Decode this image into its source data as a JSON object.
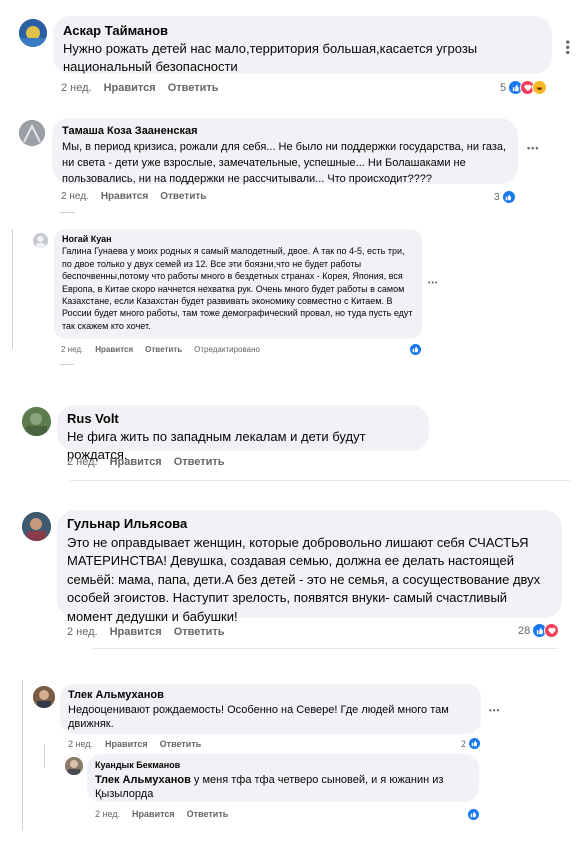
{
  "comments": [
    {
      "author": "Аскар Тайманов",
      "text": "Нужно рожать детей нас мало,территория большая,касается угрозы национальный безопасности",
      "time": "2 нед.",
      "like": "Нравится",
      "reply": "Ответить",
      "count": "5",
      "avatar_color": "#2b5fa3"
    },
    {
      "author": "Тамаша Коза Зааненская",
      "text": "Мы, в период кризиса, рожали для себя... Не было ни поддержки государства, ни газа, ни света - дети уже взрослые, замечательные, успешные... Ни Болашаками не пользовались, ни на поддержки не рассчитывали... Что происходит????",
      "time": "2 нед.",
      "like": "Нравится",
      "reply": "Ответить",
      "count": "3",
      "avatar_color": "#8a8f94"
    },
    {
      "author": "Ногай Куан",
      "text": "Галина Гунаева у моих родных я самый малодетный, двое. А так по 4-5, есть три, по двое только у двух семей из 12. Все эти боязни,что не будет работы беспочвенны,потому что работы много в бездетных странах - Корея, Япония, вся Европа, в Китае скоро начнется нехватка рук. Очень много будет работы в самом Казахстане, если Казахстан будет развивать экономику совместно с Китаем. В России будет много работы, там тоже демографический провал, но туда пусть едут так скажем кто хочет.",
      "time": "2 нед.",
      "like": "Нравится",
      "reply": "Ответить",
      "edited": "Отредактировано",
      "avatar_color": "#c8ccd1"
    },
    {
      "author": "Rus Volt",
      "text": "Не фига жить по западным лекалам и дети будут рождатся.",
      "time": "2 нед.",
      "like": "Нравится",
      "reply": "Ответить",
      "avatar_color": "#6a8a5a"
    },
    {
      "author": "Гульнар Ильясова",
      "text": "Это не оправдывает женщин, которые добровольно лишают себя СЧАСТЬЯ МАТЕРИНСТВА! Девушка, создавая семью, должна ее делать настоящей семьёй: мама, папа, дети.А без детей - это не семья, а сосуществование двух особей эгоистов. Наступит зрелость, появятся внуки- самый счастливый момент дедушки и бабушки!",
      "time": "2 нед.",
      "like": "Нравится",
      "reply": "Ответить",
      "count": "28",
      "avatar_color": "#3d5a6e"
    },
    {
      "author": "Тлек Альмуханов",
      "text": "Недооценивают рождаемость! Особенно на Севере! Где людей много там движняк.",
      "time": "2 нед.",
      "like": "Нравится",
      "reply": "Ответить",
      "count": "2",
      "avatar_color": "#7a5c44"
    },
    {
      "author": "Куандык Бекманов",
      "mention": "Тлек Альмуханов",
      "text": " у меня тфа тфа четверо сыновей, и я южанин из Қызылорда",
      "time": "2 нед.",
      "like": "Нравится",
      "reply": "Ответить",
      "avatar_color": "#8c7b6a"
    }
  ]
}
